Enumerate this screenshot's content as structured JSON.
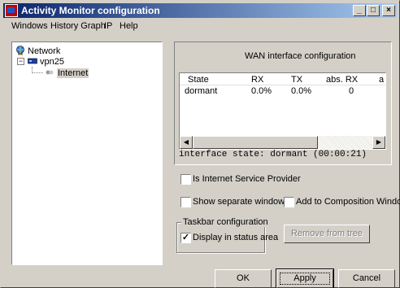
{
  "window": {
    "title": "Activity Monitor configuration"
  },
  "titlebar_buttons": {
    "minimize": "_",
    "maximize": "□",
    "close": "×"
  },
  "menu": [
    "Windows",
    "History Graph",
    "IP",
    "Help"
  ],
  "tree": {
    "root": "Network",
    "child": "vpn25",
    "grandchild": "Internet",
    "expander": "−"
  },
  "wan": {
    "title": "WAN interface configuration",
    "columns": [
      "State",
      "RX",
      "TX",
      "abs. RX",
      "a"
    ],
    "rows": [
      [
        "dormant",
        "0.0%",
        "0.0%",
        "0",
        ""
      ]
    ],
    "status": "interface state: dormant (00:00:21)",
    "scroll_left": "◀",
    "scroll_right": "▶"
  },
  "options": {
    "isp_label": "Is Internet Service Provider",
    "separate_label": "Show separate window",
    "composition_label": "Add to Composition Window",
    "taskbar_legend": "Taskbar configuration",
    "status_area_label": "Display in status area",
    "status_area_check": "✓",
    "remove_label": "Remove from tree"
  },
  "buttons": {
    "ok": "OK",
    "apply": "Apply",
    "cancel": "Cancel"
  },
  "state": {
    "isp_checked": false,
    "separate_checked": false,
    "composition_checked": false,
    "status_area_checked": true
  }
}
